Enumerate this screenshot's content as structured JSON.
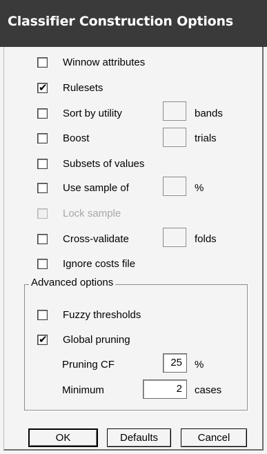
{
  "window": {
    "title": "Classifier Construction Options"
  },
  "options": {
    "winnow": {
      "label": "Winnow attributes",
      "checked": false
    },
    "rulesets": {
      "label": "Rulesets",
      "checked": true
    },
    "sort_utility": {
      "label": "Sort by utility",
      "checked": false,
      "value": "",
      "unit": "bands"
    },
    "boost": {
      "label": "Boost",
      "checked": false,
      "value": "",
      "unit": "trials"
    },
    "subsets": {
      "label": "Subsets of values",
      "checked": false
    },
    "sample": {
      "label": "Use sample of",
      "checked": false,
      "value": "",
      "unit": "%"
    },
    "lock_sample": {
      "label": "Lock sample",
      "checked": false,
      "disabled": true
    },
    "cross_validate": {
      "label": "Cross-validate",
      "checked": false,
      "value": "",
      "unit": "folds"
    },
    "ignore_costs": {
      "label": "Ignore costs file",
      "checked": false
    }
  },
  "advanced": {
    "title": "Advanced options",
    "fuzzy": {
      "label": "Fuzzy thresholds",
      "checked": false
    },
    "global_pruning": {
      "label": "Global pruning",
      "checked": true
    },
    "pruning_cf": {
      "label": "Pruning CF",
      "value": "25",
      "unit": "%"
    },
    "minimum": {
      "label": "Minimum",
      "value": "2",
      "unit": "cases"
    }
  },
  "buttons": {
    "ok": "OK",
    "defaults": "Defaults",
    "cancel": "Cancel"
  },
  "check_glyph": "✔"
}
